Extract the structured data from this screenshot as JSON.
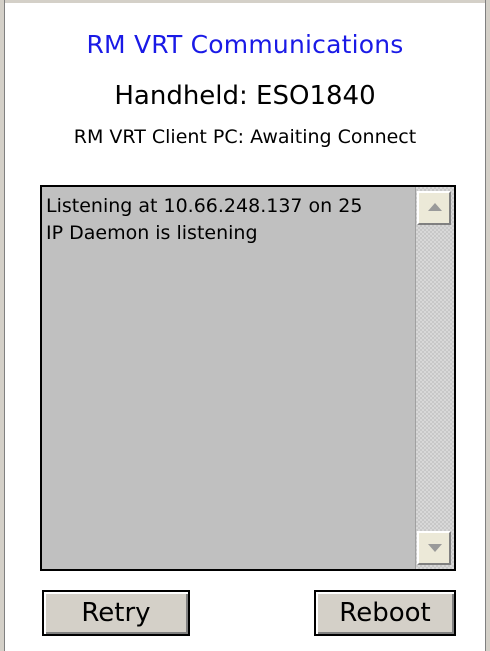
{
  "app": {
    "title": "RM VRT Communications",
    "handheld": "Handheld: ESO1840",
    "client_status": "RM VRT Client PC: Awaiting Connect"
  },
  "log": {
    "lines": [
      "Listening at 10.66.248.137 on 25",
      "IP Daemon is listening"
    ]
  },
  "buttons": {
    "retry": "Retry",
    "reboot": "Reboot"
  },
  "colors": {
    "title": "#1a1ae6",
    "log_background": "#c0c0c0",
    "button_face": "#d4d0c8"
  },
  "icons": {
    "scroll_up": "triangle-up",
    "scroll_down": "triangle-down"
  }
}
